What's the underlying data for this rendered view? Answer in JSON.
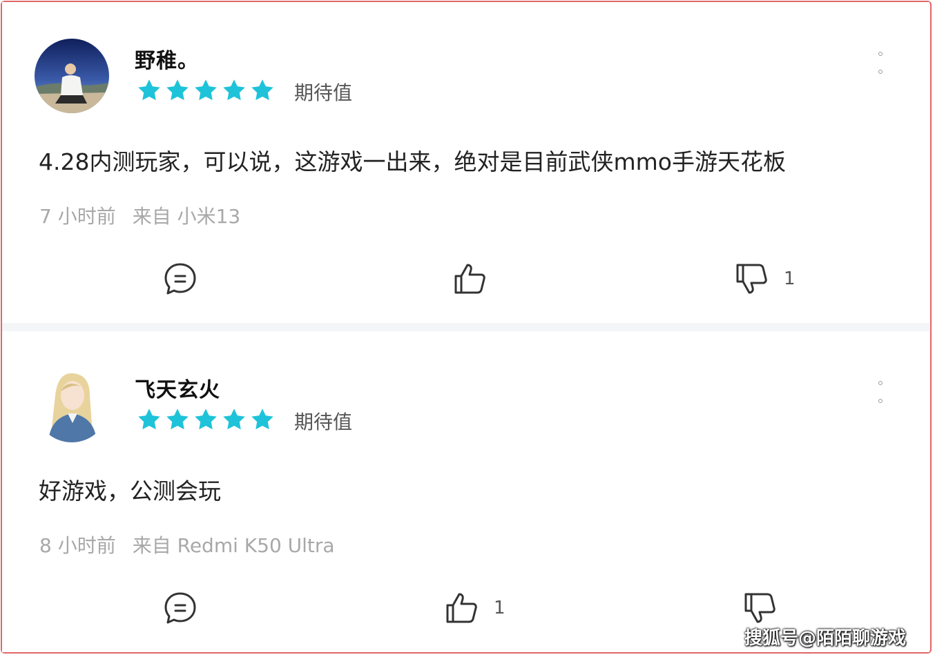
{
  "comments": [
    {
      "username": "野稚。",
      "stars": 5,
      "rating_label": "期待值",
      "content": "4.28内测玩家，可以说，这游戏一出来，绝对是目前武侠mmo手游天花板",
      "time": "7 小时前",
      "source": "来自 小米13",
      "like_count": "",
      "dislike_count": "1"
    },
    {
      "username": "飞天玄火",
      "stars": 5,
      "rating_label": "期待值",
      "content": "好游戏，公测会玩",
      "time": "8 小时前",
      "source": "来自 Redmi K50 Ultra",
      "like_count": "1",
      "dislike_count": ""
    }
  ],
  "icons": {
    "star": "star-icon",
    "reply": "comment-icon",
    "like": "thumbs-up-icon",
    "dislike": "thumbs-down-icon",
    "more": "more-vertical-icon"
  },
  "colors": {
    "star": "#1ec3d9",
    "frame": "#e06666",
    "meta_text": "#a8a8a8"
  },
  "watermark": "搜狐号@陌陌聊游戏"
}
